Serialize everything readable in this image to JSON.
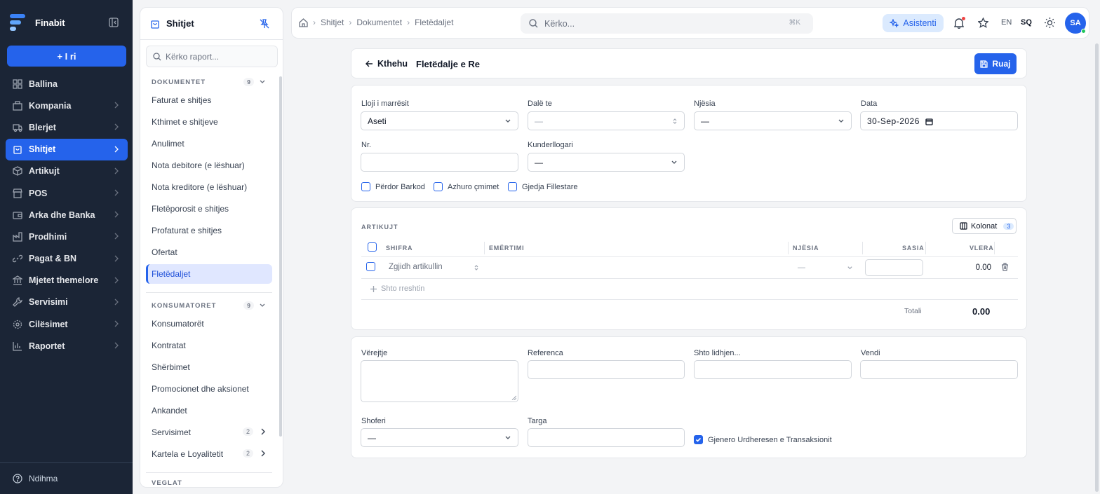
{
  "brand": {
    "name": "Finabit"
  },
  "sidebar": {
    "new_label": "+ I ri",
    "items": [
      {
        "label": "Ballina",
        "icon": "grid-icon",
        "has_arrow": false
      },
      {
        "label": "Kompania",
        "icon": "building-icon",
        "has_arrow": true
      },
      {
        "label": "Blerjet",
        "icon": "truck-icon",
        "has_arrow": true
      },
      {
        "label": "Shitjet",
        "icon": "shopping-bag-icon",
        "has_arrow": true,
        "active": true
      },
      {
        "label": "Artikujt",
        "icon": "box-icon",
        "has_arrow": true
      },
      {
        "label": "POS",
        "icon": "store-icon",
        "has_arrow": true
      },
      {
        "label": "Arka dhe Banka",
        "icon": "wallet-icon",
        "has_arrow": true
      },
      {
        "label": "Prodhimi",
        "icon": "factory-icon",
        "has_arrow": true
      },
      {
        "label": "Pagat & BN",
        "icon": "link-icon",
        "has_arrow": true
      },
      {
        "label": "Mjetet themelore",
        "icon": "bank-icon",
        "has_arrow": true
      },
      {
        "label": "Servisimi",
        "icon": "wrench-icon",
        "has_arrow": true
      },
      {
        "label": "Cilësimet",
        "icon": "gear-icon",
        "has_arrow": true
      },
      {
        "label": "Raportet",
        "icon": "bar-chart-icon",
        "has_arrow": true
      }
    ],
    "help_label": "Ndihma"
  },
  "subpanel": {
    "title": "Shitjet",
    "search_placeholder": "Kërko raport...",
    "sections": [
      {
        "title": "DOKUMENTET",
        "count": "9",
        "items": [
          {
            "label": "Faturat e shitjes"
          },
          {
            "label": "Kthimet e shitjeve"
          },
          {
            "label": "Anulimet"
          },
          {
            "label": "Nota debitore (e lëshuar)"
          },
          {
            "label": "Nota kreditore (e lëshuar)"
          },
          {
            "label": "Fletëporosit e shitjes"
          },
          {
            "label": "Profaturat e shitjes"
          },
          {
            "label": "Ofertat"
          },
          {
            "label": "Fletëdaljet",
            "active": true
          }
        ]
      },
      {
        "title": "KONSUMATORET",
        "count": "9",
        "items": [
          {
            "label": "Konsumatorët"
          },
          {
            "label": "Kontratat"
          },
          {
            "label": "Shërbimet"
          },
          {
            "label": "Promocionet dhe aksionet"
          },
          {
            "label": "Ankandet"
          },
          {
            "label": "Servisimet",
            "count": "2"
          },
          {
            "label": "Kartela e Loyalitetit",
            "count": "2"
          }
        ]
      },
      {
        "title": "VEGLAT"
      }
    ]
  },
  "topbar": {
    "breadcrumbs": [
      "Shitjet",
      "Dokumentet",
      "Fletëdaljet"
    ],
    "search_placeholder": "Kërko...",
    "shortcut": "⌘K",
    "assistant_label": "Asistenti",
    "lang_en": "EN",
    "lang_sq": "SQ",
    "avatar": "SA"
  },
  "doc": {
    "back_label": "Kthehu",
    "title": "Fletëdalje e Re",
    "save_label": "Ruaj"
  },
  "form": {
    "receiver_type": {
      "label": "Lloji i marrësit",
      "value": "Aseti"
    },
    "exit_to": {
      "label": "Dalë te",
      "value": "—"
    },
    "unit": {
      "label": "Njësia",
      "value": "—"
    },
    "date": {
      "label": "Data",
      "value": "30-Sep-2026"
    },
    "nr": {
      "label": "Nr.",
      "value": ""
    },
    "account": {
      "label": "Kunderllogari",
      "value": "—"
    },
    "checkboxes": [
      {
        "label": "Përdor Barkod",
        "checked": false
      },
      {
        "label": "Azhuro çmimet",
        "checked": false
      },
      {
        "label": "Gjedja Fillestare",
        "checked": false
      }
    ]
  },
  "items": {
    "caption": "ARTIKUJT",
    "columns_label": "Kolonat",
    "columns_count": "3",
    "headers": [
      "SHIFRA",
      "EMËRTIMI",
      "NJËSIA",
      "SASIA",
      "VLERA"
    ],
    "row": {
      "placeholder": "Zgjidh artikullin",
      "unit": "—",
      "qty": "",
      "value": "0.00"
    },
    "add_row": "Shto rreshtin",
    "total_label": "Totali",
    "total_value": "0.00"
  },
  "footer": {
    "notes_label": "Vërejtje",
    "reference_label": "Referenca",
    "link_label": "Shto lidhjen...",
    "place_label": "Vendi",
    "driver": {
      "label": "Shoferi",
      "value": "—"
    },
    "plate_label": "Targa",
    "generate": {
      "label": "Gjenero Urdheresen e Transaksionit",
      "checked": true
    }
  },
  "colors": {
    "primary": "#2563eb",
    "sidebar_bg": "#1b2536"
  }
}
